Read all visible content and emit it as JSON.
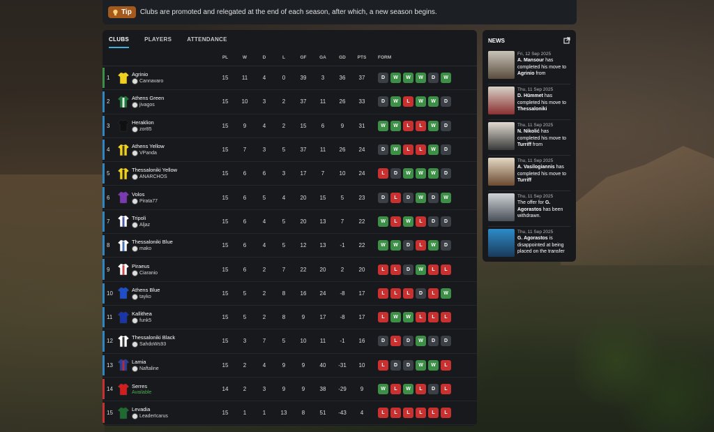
{
  "tip": {
    "label": "Tip",
    "text": "Clubs are promoted and relegated at the end of each season, after which, a new season begins."
  },
  "tabs": [
    "CLUBS",
    "PLAYERS",
    "ATTENDANCE"
  ],
  "columns": {
    "pl": "PL",
    "w": "W",
    "d": "D",
    "l": "L",
    "gf": "GF",
    "ga": "GA",
    "gd": "GD",
    "pts": "PTS",
    "form": "FORM"
  },
  "colors": {
    "promotion": "#3d8f47",
    "mid": "#2f86c4",
    "relegation": "#c93030",
    "win": "#3d8f47",
    "loss": "#c93030",
    "draw": "#3b3f46"
  },
  "rows": [
    {
      "pos": "1",
      "club": "Agrinio",
      "manager": "Cannavaro",
      "pl": "15",
      "w": "11",
      "d": "4",
      "l": "0",
      "gf": "39",
      "ga": "3",
      "gd": "36",
      "pts": "37",
      "form": [
        "D",
        "W",
        "W",
        "W",
        "D",
        "W"
      ],
      "zone": "promotion",
      "shirt": [
        "#f0d020",
        "#f0d020"
      ]
    },
    {
      "pos": "2",
      "club": "Athens Green",
      "manager": "jivagos",
      "pl": "15",
      "w": "10",
      "d": "3",
      "l": "2",
      "gf": "37",
      "ga": "11",
      "gd": "26",
      "pts": "33",
      "form": [
        "D",
        "W",
        "L",
        "W",
        "W",
        "D"
      ],
      "zone": "mid",
      "shirt": [
        "#1e7a3a",
        "#ffffff"
      ]
    },
    {
      "pos": "3",
      "club": "Heraklion",
      "manager": "zor85",
      "pl": "15",
      "w": "9",
      "d": "4",
      "l": "2",
      "gf": "15",
      "ga": "6",
      "gd": "9",
      "pts": "31",
      "form": [
        "W",
        "W",
        "L",
        "L",
        "W",
        "D"
      ],
      "zone": "mid",
      "shirt": [
        "#111111",
        "#111111"
      ]
    },
    {
      "pos": "4",
      "club": "Athens Yellow",
      "manager": "VPanda",
      "pl": "15",
      "w": "7",
      "d": "3",
      "l": "5",
      "gf": "37",
      "ga": "11",
      "gd": "26",
      "pts": "24",
      "form": [
        "D",
        "W",
        "L",
        "L",
        "W",
        "D"
      ],
      "zone": "mid",
      "shirt": [
        "#f0d020",
        "#222222"
      ]
    },
    {
      "pos": "5",
      "club": "Thessaloniki Yellow",
      "manager": "ANARCHOS",
      "pl": "15",
      "w": "6",
      "d": "6",
      "l": "3",
      "gf": "17",
      "ga": "7",
      "gd": "10",
      "pts": "24",
      "form": [
        "L",
        "D",
        "W",
        "W",
        "W",
        "D"
      ],
      "zone": "mid",
      "shirt": [
        "#f0d020",
        "#111111"
      ]
    },
    {
      "pos": "6",
      "club": "Volos",
      "manager": "Pirata77",
      "pl": "15",
      "w": "6",
      "d": "5",
      "l": "4",
      "gf": "20",
      "ga": "15",
      "gd": "5",
      "pts": "23",
      "form": [
        "D",
        "L",
        "D",
        "W",
        "D",
        "W"
      ],
      "zone": "mid",
      "shirt": [
        "#7a3ab0",
        "#7a3ab0"
      ]
    },
    {
      "pos": "7",
      "club": "Tripoli",
      "manager": "Aljaz",
      "pl": "15",
      "w": "6",
      "d": "4",
      "l": "5",
      "gf": "20",
      "ga": "13",
      "gd": "7",
      "pts": "22",
      "form": [
        "W",
        "L",
        "W",
        "L",
        "D",
        "D"
      ],
      "zone": "mid",
      "shirt": [
        "#ffffff",
        "#2a3f9a"
      ]
    },
    {
      "pos": "8",
      "club": "Thessaloniki Blue",
      "manager": "mako",
      "pl": "15",
      "w": "6",
      "d": "4",
      "l": "5",
      "gf": "12",
      "ga": "13",
      "gd": "-1",
      "pts": "22",
      "form": [
        "W",
        "W",
        "D",
        "L",
        "W",
        "D"
      ],
      "zone": "mid",
      "shirt": [
        "#ffffff",
        "#2a5fb0"
      ]
    },
    {
      "pos": "9",
      "club": "Piraeus",
      "manager": "Ciaranio",
      "pl": "15",
      "w": "6",
      "d": "2",
      "l": "7",
      "gf": "22",
      "ga": "20",
      "gd": "2",
      "pts": "20",
      "form": [
        "L",
        "L",
        "D",
        "W",
        "L",
        "L"
      ],
      "zone": "mid",
      "shirt": [
        "#ffffff",
        "#c92a2a"
      ]
    },
    {
      "pos": "10",
      "club": "Athens Blue",
      "manager": "tayko",
      "pl": "15",
      "w": "5",
      "d": "2",
      "l": "8",
      "gf": "16",
      "ga": "24",
      "gd": "-8",
      "pts": "17",
      "form": [
        "L",
        "L",
        "L",
        "D",
        "L",
        "W"
      ],
      "zone": "mid",
      "shirt": [
        "#1f4fc8",
        "#1f4fc8"
      ]
    },
    {
      "pos": "11",
      "club": "Kallithea",
      "manager": "funk5",
      "pl": "15",
      "w": "5",
      "d": "2",
      "l": "8",
      "gf": "9",
      "ga": "17",
      "gd": "-8",
      "pts": "17",
      "form": [
        "L",
        "W",
        "W",
        "L",
        "L",
        "L"
      ],
      "zone": "mid",
      "shirt": [
        "#1a35a8",
        "#1a35a8"
      ]
    },
    {
      "pos": "12",
      "club": "Thessaloniki Black",
      "manager": "SahdoWs93",
      "pl": "15",
      "w": "3",
      "d": "7",
      "l": "5",
      "gf": "10",
      "ga": "11",
      "gd": "-1",
      "pts": "16",
      "form": [
        "D",
        "L",
        "D",
        "W",
        "D",
        "D"
      ],
      "zone": "mid",
      "shirt": [
        "#ffffff",
        "#111111"
      ]
    },
    {
      "pos": "13",
      "club": "Lamia",
      "manager": "Naftaline",
      "pl": "15",
      "w": "2",
      "d": "4",
      "l": "9",
      "gf": "9",
      "ga": "40",
      "gd": "-31",
      "pts": "10",
      "form": [
        "L",
        "D",
        "D",
        "W",
        "W",
        "L"
      ],
      "zone": "mid",
      "shirt": [
        "#2a3f9a",
        "#c92a2a"
      ]
    },
    {
      "pos": "14",
      "club": "Serres",
      "manager": "Available",
      "pl": "14",
      "w": "2",
      "d": "3",
      "l": "9",
      "gf": "9",
      "ga": "38",
      "gd": "-29",
      "pts": "9",
      "form": [
        "W",
        "L",
        "W",
        "L",
        "D",
        "L"
      ],
      "zone": "relegation",
      "shirt": [
        "#d01f1f",
        "#d01f1f"
      ],
      "available": true
    },
    {
      "pos": "15",
      "club": "Levadia",
      "manager": "LeaderIcarus",
      "pl": "15",
      "w": "1",
      "d": "1",
      "l": "13",
      "gf": "8",
      "ga": "51",
      "gd": "-43",
      "pts": "4",
      "form": [
        "L",
        "L",
        "L",
        "L",
        "L",
        "L"
      ],
      "zone": "relegation",
      "shirt": [
        "#1e6a30",
        "#1e6a30"
      ]
    }
  ],
  "news": {
    "title": "NEWS",
    "items": [
      {
        "date": "Fri, 12 Sep 2025",
        "parts": [
          {
            "t": "A. Mansour",
            "b": true
          },
          {
            "t": " has completed his move to "
          },
          {
            "t": "Agrinio",
            "b": true
          },
          {
            "t": " from "
          }
        ],
        "thumb": [
          "#c9c3b8",
          "#5a4d3e"
        ]
      },
      {
        "date": "Thu, 11 Sep 2025",
        "parts": [
          {
            "t": "D. Hümmet",
            "b": true
          },
          {
            "t": " has completed his move to "
          },
          {
            "t": "Thessaloniki",
            "b": true
          }
        ],
        "thumb": [
          "#d8d2c8",
          "#8a3030"
        ]
      },
      {
        "date": "Thu, 11 Sep 2025",
        "parts": [
          {
            "t": "N. Nikolić",
            "b": true
          },
          {
            "t": " has completed his move to "
          },
          {
            "t": "Turriff",
            "b": true
          },
          {
            "t": " from "
          }
        ],
        "thumb": [
          "#e0dad0",
          "#3a3a3a"
        ]
      },
      {
        "date": "Thu, 11 Sep 2025",
        "parts": [
          {
            "t": "A. Vasilogiannis",
            "b": true
          },
          {
            "t": " has completed his move to "
          },
          {
            "t": "Turriff",
            "b": true
          }
        ],
        "thumb": [
          "#e4d8c4",
          "#6a4a30"
        ]
      },
      {
        "date": "Thu, 11 Sep 2025",
        "parts": [
          {
            "t": "The offer for "
          },
          {
            "t": "G. Agorastos",
            "b": true
          },
          {
            "t": " has been withdrawn."
          }
        ],
        "thumb": [
          "#d0d4d8",
          "#4a5058"
        ]
      },
      {
        "date": "Thu, 11 Sep 2025",
        "parts": [
          {
            "t": "G. Agorastos",
            "b": true
          },
          {
            "t": " is disappointed at being placed on the transfer"
          }
        ],
        "thumb": [
          "#2d8cc8",
          "#1a3a5a"
        ]
      }
    ]
  }
}
